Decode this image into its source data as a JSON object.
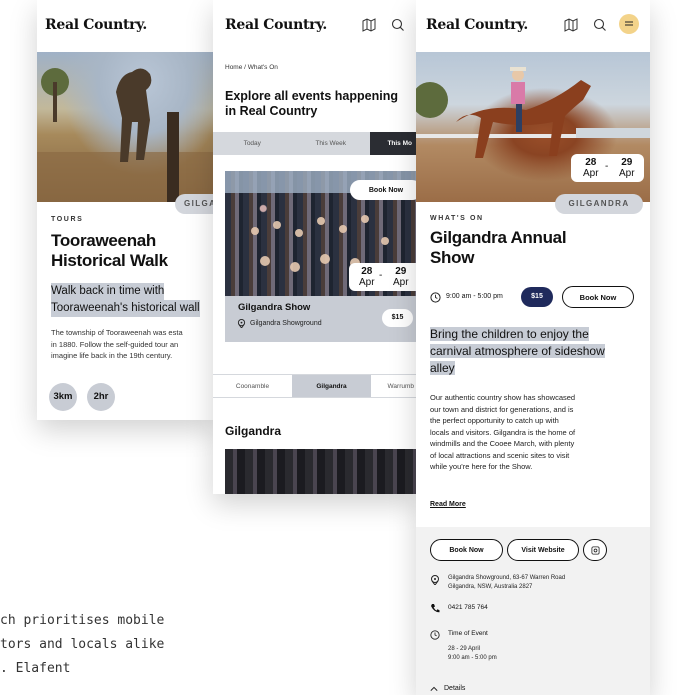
{
  "brand": {
    "name": "Real Country."
  },
  "colors": {
    "navy": "#1f2a5c",
    "highlight": "#c7ccd5",
    "accent_yellow": "#f3d38a",
    "grey_panel": "#f2f2f2"
  },
  "left_phone": {
    "location_chip": "GILGA",
    "tag": "TOURS",
    "title_line1": "Tooraweenah",
    "title_line2": "Historical Walk",
    "subtitle_line1": "Walk back in time with",
    "subtitle_line2": "Tooraweenah's historical wall",
    "body_line1": "The township of Tooraweenah was esta",
    "body_line2": "in 1880. Follow the self-guided tour an",
    "body_line3": "imagine life back in the 19th century.",
    "badge_distance": "3km",
    "badge_time": "2hr"
  },
  "middle_phone": {
    "breadcrumb": "Home / What's On",
    "heading_line1": "Explore all events happening",
    "heading_line2": "in Real Country",
    "tabs": [
      {
        "label": "Today"
      },
      {
        "label": "This Week"
      },
      {
        "label": "This Mo"
      }
    ],
    "book_now": "Book Now",
    "date_from_day": "28",
    "date_from_month": "Apr",
    "date_sep": "-",
    "date_to_day": "29",
    "date_to_month": "Apr",
    "event_title": "Gilgandra Show",
    "event_location": "Gilgandra Showground",
    "price": "$15",
    "region_tabs": [
      {
        "label": "Coonamble"
      },
      {
        "label": "Gilgandra"
      },
      {
        "label": "Warrumb"
      }
    ],
    "region_heading": "Gilgandra"
  },
  "right_phone": {
    "date_from_day": "28",
    "date_from_month": "Apr",
    "date_sep": "-",
    "date_to_day": "29",
    "date_to_month": "Apr",
    "location_chip": "GILGANDRA",
    "tag": "WHAT'S ON",
    "title_line1": "Gilgandra Annual",
    "title_line2": "Show",
    "time": "9:00 am - 5:00 pm",
    "price": "$15",
    "book_now": "Book Now",
    "subtitle_line1": "Bring the children to enjoy the",
    "subtitle_line2": "carnival atmosphere of sideshow",
    "subtitle_line3": "alley",
    "body_lines": [
      "Our authentic country show has showcased",
      "our town and district for generations, and is",
      "the perfect opportunity to catch up with",
      "locals and visitors. Gilgandra is the home of",
      "windmills and the Cooee March, with plenty",
      "of local attractions and scenic sites to visit",
      "while you're here for the Show."
    ],
    "read_more": "Read More",
    "book_now_2": "Book Now",
    "visit_website": "Visit Website",
    "address_line1": "Gilgandra Showground, 63-67 Warren Road",
    "address_line2": "Gilgandra, NSW, Australia 2827",
    "phone": "0421 785 764",
    "time_label": "Time of Event",
    "time_dates": "28 - 29 April",
    "time_hours": "9:00 am - 5:00 pm",
    "details": "Details"
  },
  "caption": {
    "line1": "ch prioritises mobile",
    "line2": "tors and locals alike",
    "line3": ". Elafent"
  }
}
